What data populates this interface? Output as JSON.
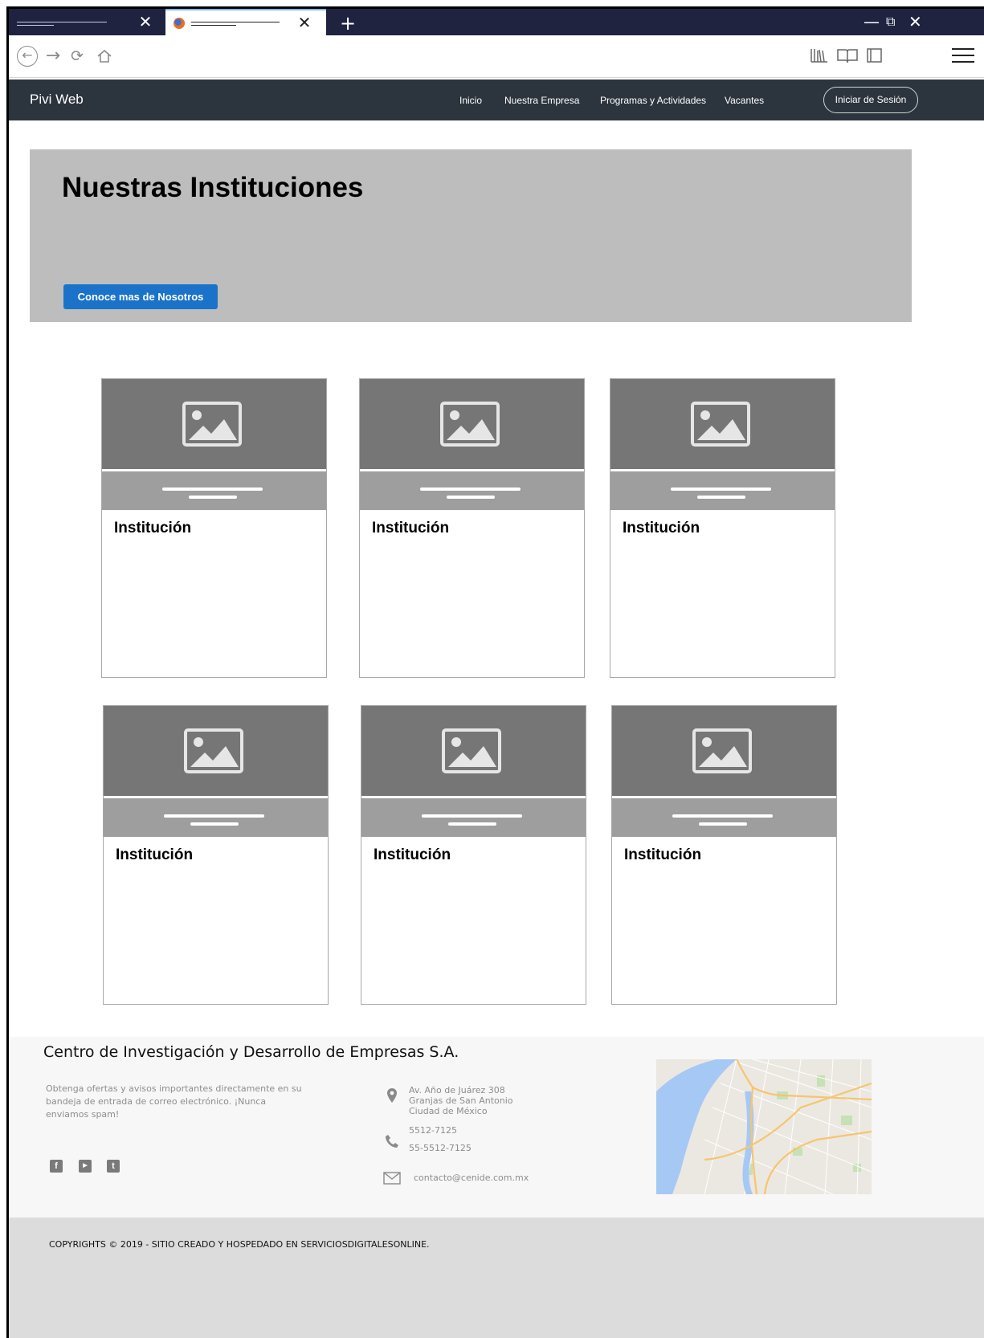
{
  "browser": {
    "tabs": [
      {
        "label": ""
      },
      {
        "label": ""
      }
    ],
    "new_tab_symbol": "+",
    "close_symbol": "✕",
    "window_controls": {
      "minimize": "—",
      "restore": "⧉",
      "close": "✕"
    }
  },
  "site": {
    "brand": "Pivi Web",
    "nav": [
      "Inicio",
      "Nuestra Empresa",
      "Programas y Actividades",
      "Vacantes"
    ],
    "login_label": "Iniciar de Sesión"
  },
  "hero": {
    "title": "Nuestras Instituciones",
    "button_label": "Conoce mas de Nosotros"
  },
  "cards": [
    {
      "title": "Institución"
    },
    {
      "title": "Institución"
    },
    {
      "title": "Institución"
    },
    {
      "title": "Institución"
    },
    {
      "title": "Institución"
    },
    {
      "title": "Institución"
    }
  ],
  "footer": {
    "company": "Centro de Investigación y Desarrollo de Empresas S.A.",
    "description": "Obtenga ofertas y avisos importantes directamente en su bandeja de entrada de correo electrónico. ¡Nunca enviamos spam!",
    "address": [
      "Av. Año de Juárez 308",
      "Granjas de San Antonio",
      "Ciudad de México"
    ],
    "phones": [
      "5512-7125",
      "55-5512-7125"
    ],
    "email": "contacto@cenide.com.mx",
    "social": [
      "facebook-icon",
      "youtube-icon",
      "twitter-icon"
    ],
    "copyright": "COPYRIGHTS © 2019 - SITIO CREADO Y HOSPEDADO EN SERVICIOSDIGITALESONLINE."
  },
  "colors": {
    "tabbar": "#1f2340",
    "navbar": "#2c343d",
    "hero_bg": "#bdbdbd",
    "button": "#1a73c8",
    "card_image": "#767676",
    "card_band": "#9e9e9e",
    "footer_bg": "#f7f7f7",
    "copyright_bg": "#dcdcdc"
  }
}
